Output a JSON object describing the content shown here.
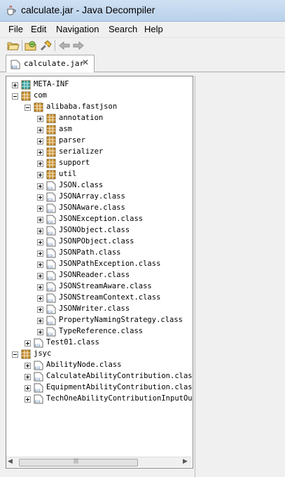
{
  "window": {
    "title": "calculate.jar - Java Decompiler"
  },
  "menu": [
    "File",
    "Edit",
    "Navigation",
    "Search",
    "Help"
  ],
  "tab": {
    "label": "calculate.jar",
    "close": "✕"
  },
  "tree": [
    {
      "label": "META-INF",
      "depth": 0,
      "type": "package-root",
      "expander": "plus"
    },
    {
      "label": "com",
      "depth": 0,
      "type": "package",
      "expander": "minus"
    },
    {
      "label": "alibaba.fastjson",
      "depth": 1,
      "type": "package",
      "expander": "minus"
    },
    {
      "label": "annotation",
      "depth": 2,
      "type": "package",
      "expander": "plus"
    },
    {
      "label": "asm",
      "depth": 2,
      "type": "package",
      "expander": "plus"
    },
    {
      "label": "parser",
      "depth": 2,
      "type": "package",
      "expander": "plus"
    },
    {
      "label": "serializer",
      "depth": 2,
      "type": "package",
      "expander": "plus"
    },
    {
      "label": "support",
      "depth": 2,
      "type": "package",
      "expander": "plus"
    },
    {
      "label": "util",
      "depth": 2,
      "type": "package",
      "expander": "plus"
    },
    {
      "label": "JSON.class",
      "depth": 2,
      "type": "class",
      "expander": "plus"
    },
    {
      "label": "JSONArray.class",
      "depth": 2,
      "type": "class",
      "expander": "plus"
    },
    {
      "label": "JSONAware.class",
      "depth": 2,
      "type": "class",
      "expander": "plus"
    },
    {
      "label": "JSONException.class",
      "depth": 2,
      "type": "class",
      "expander": "plus"
    },
    {
      "label": "JSONObject.class",
      "depth": 2,
      "type": "class",
      "expander": "plus"
    },
    {
      "label": "JSONPObject.class",
      "depth": 2,
      "type": "class",
      "expander": "plus"
    },
    {
      "label": "JSONPath.class",
      "depth": 2,
      "type": "class",
      "expander": "plus"
    },
    {
      "label": "JSONPathException.class",
      "depth": 2,
      "type": "class",
      "expander": "plus"
    },
    {
      "label": "JSONReader.class",
      "depth": 2,
      "type": "class",
      "expander": "plus"
    },
    {
      "label": "JSONStreamAware.class",
      "depth": 2,
      "type": "class",
      "expander": "plus"
    },
    {
      "label": "JSONStreamContext.class",
      "depth": 2,
      "type": "class",
      "expander": "plus"
    },
    {
      "label": "JSONWriter.class",
      "depth": 2,
      "type": "class",
      "expander": "plus"
    },
    {
      "label": "PropertyNamingStrategy.class",
      "depth": 2,
      "type": "class",
      "expander": "plus"
    },
    {
      "label": "TypeReference.class",
      "depth": 2,
      "type": "class",
      "expander": "plus"
    },
    {
      "label": "Test01.class",
      "depth": 1,
      "type": "class",
      "expander": "plus"
    },
    {
      "label": "jsyc",
      "depth": 0,
      "type": "package",
      "expander": "minus"
    },
    {
      "label": "AbilityNode.class",
      "depth": 1,
      "type": "class",
      "expander": "plus"
    },
    {
      "label": "CalculateAbilityContribution.class",
      "depth": 1,
      "type": "class",
      "expander": "plus"
    },
    {
      "label": "EquipmentAbilityContribution.class",
      "depth": 1,
      "type": "class",
      "expander": "plus"
    },
    {
      "label": "TechOneAbilityContributionInputOutput",
      "depth": 1,
      "type": "class",
      "expander": "plus"
    }
  ],
  "icons": {
    "open": "open-folder-icon",
    "open_type": "browse-type-icon",
    "search": "search-flashlight-icon",
    "back": "back-arrow-icon",
    "forward": "forward-arrow-icon"
  },
  "colors": {
    "package": "#c98f2a",
    "root": "#2aa0a0",
    "class": "#5b7fb7"
  }
}
